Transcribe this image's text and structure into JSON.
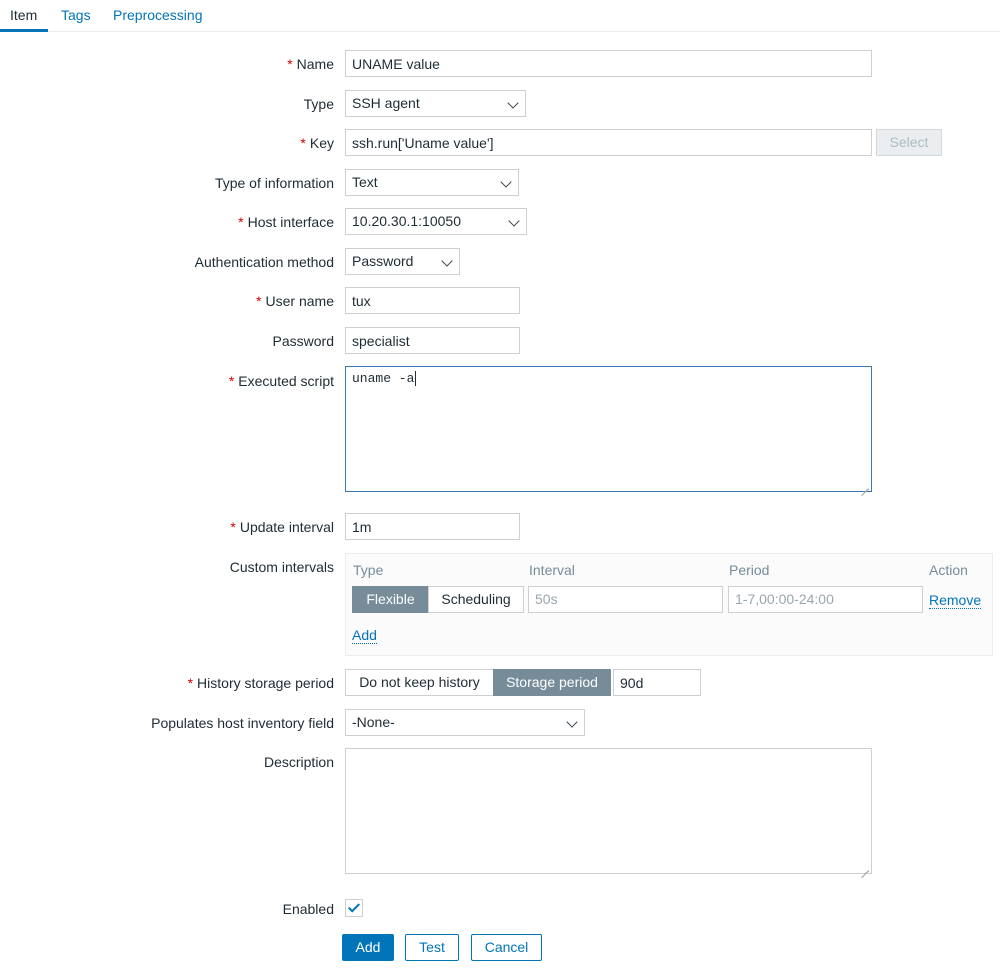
{
  "tabs": [
    {
      "label": "Item",
      "active": true
    },
    {
      "label": "Tags",
      "active": false
    },
    {
      "label": "Preprocessing",
      "active": false
    }
  ],
  "required_mark": "*",
  "form": {
    "name": {
      "label": "Name",
      "value": "UNAME value"
    },
    "type": {
      "label": "Type",
      "value": "SSH agent"
    },
    "key": {
      "label": "Key",
      "value": "ssh.run['Uname value']",
      "select_button": "Select"
    },
    "type_of_information": {
      "label": "Type of information",
      "value": "Text"
    },
    "host_interface": {
      "label": "Host interface",
      "value": "10.20.30.1:10050"
    },
    "authentication_method": {
      "label": "Authentication method",
      "value": "Password"
    },
    "user_name": {
      "label": "User name",
      "value": "tux"
    },
    "password": {
      "label": "Password",
      "value": "specialist"
    },
    "executed_script": {
      "label": "Executed script",
      "value": "uname -a"
    },
    "update_interval": {
      "label": "Update interval",
      "value": "1m"
    },
    "custom_intervals": {
      "label": "Custom intervals",
      "headers": {
        "type": "Type",
        "interval": "Interval",
        "period": "Period",
        "action": "Action"
      },
      "row": {
        "type_options": [
          "Flexible",
          "Scheduling"
        ],
        "type_selected": "Flexible",
        "interval_placeholder": "50s",
        "period_placeholder": "1-7,00:00-24:00",
        "remove_label": "Remove"
      },
      "add_label": "Add"
    },
    "history_storage_period": {
      "label": "History storage period",
      "options": [
        "Do not keep history",
        "Storage period"
      ],
      "selected": "Storage period",
      "value": "90d"
    },
    "inventory_field": {
      "label": "Populates host inventory field",
      "value": "-None-"
    },
    "description": {
      "label": "Description",
      "value": ""
    },
    "enabled": {
      "label": "Enabled",
      "checked": true
    }
  },
  "buttons": {
    "add": "Add",
    "test": "Test",
    "cancel": "Cancel"
  },
  "colors": {
    "accent": "#0275b8",
    "required": "#d40000",
    "segment_active": "#768d99"
  }
}
